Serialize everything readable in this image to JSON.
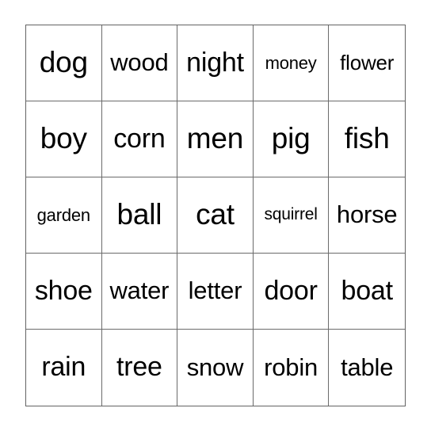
{
  "card": {
    "type": "bingo-card",
    "columns": 5,
    "rows": 5,
    "grid_line_color": "#6b6b6b",
    "border_color": "#636363",
    "text_color": "#000000",
    "background_color": "#ffffff",
    "cells": [
      [
        {
          "label": "dog",
          "size": "fs-xl"
        },
        {
          "label": "wood",
          "size": "fs-md"
        },
        {
          "label": "night",
          "size": "fs-lg"
        },
        {
          "label": "money",
          "size": "fs-xs"
        },
        {
          "label": "flower",
          "size": "fs-sm"
        }
      ],
      [
        {
          "label": "boy",
          "size": "fs-xl"
        },
        {
          "label": "corn",
          "size": "fs-lg"
        },
        {
          "label": "men",
          "size": "fs-xl"
        },
        {
          "label": "pig",
          "size": "fs-xl"
        },
        {
          "label": "fish",
          "size": "fs-xl"
        }
      ],
      [
        {
          "label": "garden",
          "size": "fs-xs"
        },
        {
          "label": "ball",
          "size": "fs-xl"
        },
        {
          "label": "cat",
          "size": "fs-xl"
        },
        {
          "label": "squirrel",
          "size": "fs-xxs"
        },
        {
          "label": "horse",
          "size": "fs-md"
        }
      ],
      [
        {
          "label": "shoe",
          "size": "fs-lg"
        },
        {
          "label": "water",
          "size": "fs-md"
        },
        {
          "label": "letter",
          "size": "fs-md"
        },
        {
          "label": "door",
          "size": "fs-lg"
        },
        {
          "label": "boat",
          "size": "fs-lg"
        }
      ],
      [
        {
          "label": "rain",
          "size": "fs-lg"
        },
        {
          "label": "tree",
          "size": "fs-lg"
        },
        {
          "label": "snow",
          "size": "fs-md"
        },
        {
          "label": "robin",
          "size": "fs-md"
        },
        {
          "label": "table",
          "size": "fs-md"
        }
      ]
    ]
  }
}
